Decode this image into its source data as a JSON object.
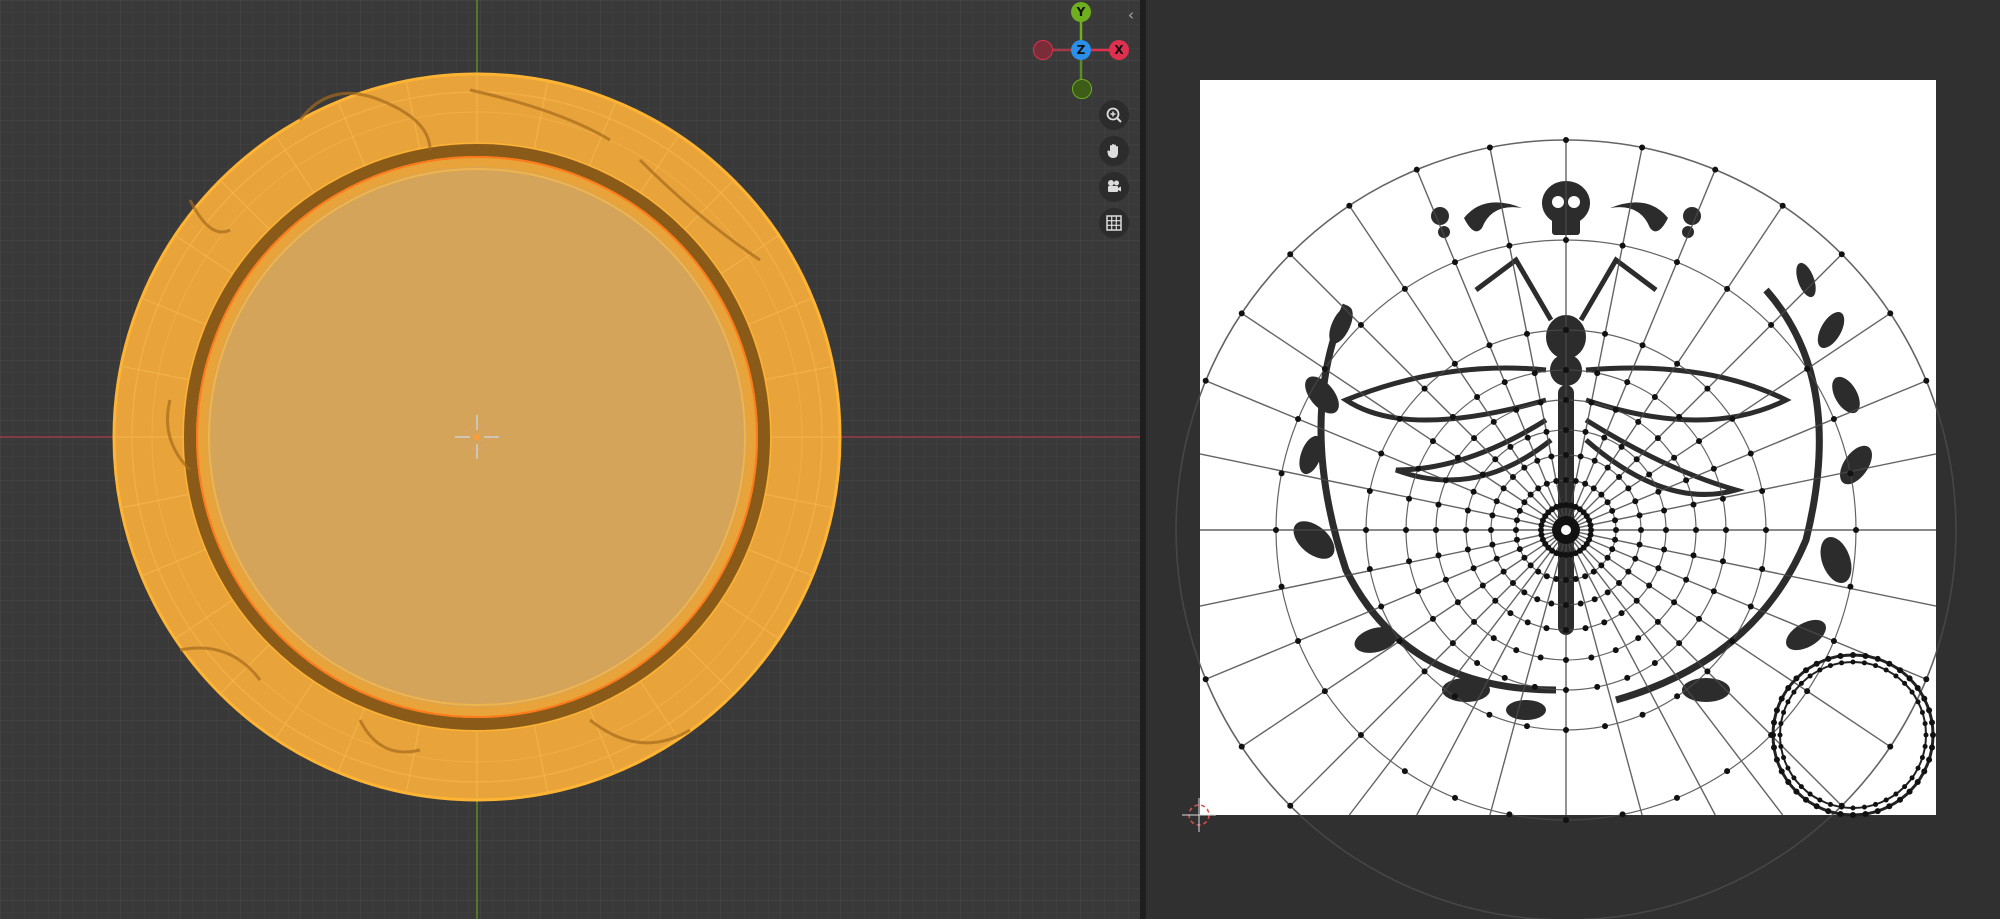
{
  "viewport": {
    "background": "#393939",
    "mesh_color": "#e8a33a",
    "edge_color": "#ffb433",
    "gizmo": {
      "labels": {
        "x": "X",
        "y": "Y",
        "z": "Z"
      },
      "colors": {
        "x": "#e0304f",
        "y": "#6fae1e",
        "z": "#2a8fe8"
      }
    },
    "nav_icons": [
      "zoom-icon",
      "pan-hand-icon",
      "camera-icon",
      "grid-icon"
    ]
  },
  "uv_editor": {
    "background": "#303030",
    "image_background": "#ffffff",
    "uv_line_color": "#2a2a2a"
  }
}
